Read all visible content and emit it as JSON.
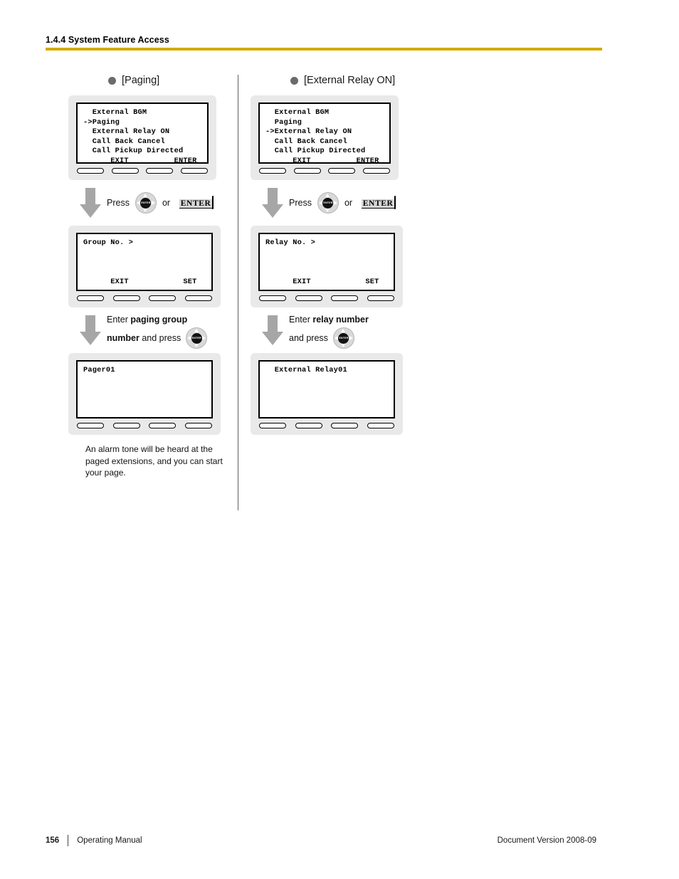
{
  "header": {
    "section_title": "1.4.4 System Feature Access",
    "rule_color": "#D4AA00"
  },
  "columns": [
    {
      "id": "paging",
      "heading": "[Paging]",
      "steps": [
        {
          "type": "lcd-menu",
          "lines": [
            "  External BGM",
            "->Paging",
            "  External Relay ON",
            "  Call Back Cancel",
            "  Call Pickup Directed"
          ],
          "softkey_line": "      EXIT          ENTER"
        },
        {
          "type": "press",
          "press_label": "Press",
          "or_label": "or",
          "nav_key_label": "ENTER",
          "enter_key_label": "ENTER"
        },
        {
          "type": "lcd-form",
          "lines": [
            "Group No. >"
          ],
          "softkey_line": "      EXIT            SET"
        },
        {
          "type": "instruction",
          "line1_plain": "Enter ",
          "line1_bold": "paging group",
          "line2_bold": "number",
          "line2_plain": " and press",
          "nav_key_label": "ENTER"
        },
        {
          "type": "lcd-result",
          "lines": [
            "Pager01"
          ]
        },
        {
          "type": "note",
          "text": "An alarm tone will be heard at the paged extensions, and you can start your page."
        }
      ]
    },
    {
      "id": "external-relay-on",
      "heading": "[External Relay ON]",
      "steps": [
        {
          "type": "lcd-menu",
          "lines": [
            "  External BGM",
            "  Paging",
            "->External Relay ON",
            "  Call Back Cancel",
            "  Call Pickup Directed"
          ],
          "softkey_line": "      EXIT          ENTER"
        },
        {
          "type": "press",
          "press_label": "Press",
          "or_label": "or",
          "nav_key_label": "ENTER",
          "enter_key_label": "ENTER"
        },
        {
          "type": "lcd-form",
          "lines": [
            "Relay No. >"
          ],
          "softkey_line": "      EXIT            SET"
        },
        {
          "type": "instruction",
          "line1_plain": "Enter ",
          "line1_bold": "relay number",
          "line2_bold": "",
          "line2_plain": "and press",
          "nav_key_label": "ENTER"
        },
        {
          "type": "lcd-result",
          "lines": [
            "  External Relay01"
          ]
        }
      ]
    }
  ],
  "footer": {
    "page_number": "156",
    "manual_label": "Operating Manual",
    "document_version": "Document Version  2008-09"
  }
}
